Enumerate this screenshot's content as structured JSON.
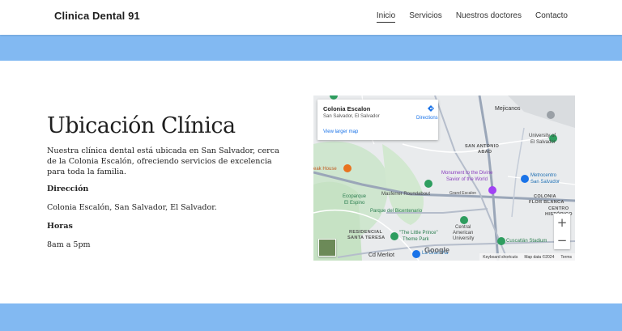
{
  "header": {
    "brand": "Clinica Dental 91",
    "nav": [
      "Inicio",
      "Servicios",
      "Nuestros doctores",
      "Contacto"
    ]
  },
  "main": {
    "title": "Ubicación Clínica",
    "description": "Nuestra clínica dental está ubicada en San Salvador, cerca de la Colonia Escalón, ofreciendo servicios de excelencia para toda la familia.",
    "address_label": "Dirección",
    "address_value": "Colonia Escalón, San Salvador, El Salvador.",
    "hours_label": "Horas",
    "hours_value": "8am a 5pm"
  },
  "map": {
    "place_name": "Colonia Escalon",
    "place_address": "San Salvador, El Salvador",
    "larger_map": "View larger map",
    "directions": "Directions",
    "labels": {
      "mejicanos": "Mejicanos",
      "univ_es": "University of",
      "univ_es2": "El Salvador",
      "san_antonio": "SAN ANTONIO",
      "abad": "ABAD",
      "steak": "eak House",
      "monument": "Monument to the Divine",
      "monument2": "Savior of the World",
      "metrocentro": "Metrocentro",
      "metrocentro2": "San Salvador",
      "ecoparque": "Ecoparque",
      "espino": "El Espino",
      "masferrer": "Masferrer Roundabout",
      "grand": "Grand Escalon",
      "bicentenario": "Parque del Bicentenario",
      "colonia": "COLONIA",
      "flor": "FLOR BLANCA",
      "centro": "CENTRO",
      "historico": "HISTÓRICO",
      "residencial": "RESIDENCIAL",
      "santa_teresa": "SANTA TERESA",
      "little_prince": "\"The Little Prince\"",
      "theme_park": "Theme Park",
      "central_am": "Central",
      "central_am2": "American",
      "central_am3": "University",
      "cuscatlan": "Cuscatlán Stadium",
      "merliot": "Cd Merliot",
      "gran_via": "La Gran Vía"
    },
    "google": "Google",
    "footer": [
      "Keyboard shortcuts",
      "Map data ©2024",
      "Terms"
    ]
  },
  "colors": {
    "band": "#82b9f2",
    "link": "#1a73e8"
  }
}
